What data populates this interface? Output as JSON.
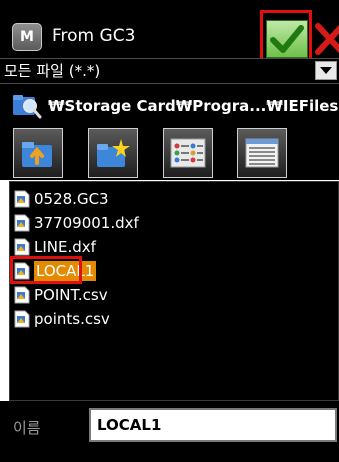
{
  "titlebar": {
    "app_icon_letter": "M",
    "title": "From GC3"
  },
  "filter": {
    "selected": "모든 파일 (*.*)"
  },
  "path": {
    "text": "₩Storage Card₩Progra...₩IEFiles"
  },
  "toolbar": {
    "buttons": [
      {
        "icon": "folder-up-icon"
      },
      {
        "icon": "new-folder-icon"
      },
      {
        "icon": "list-view-icon"
      },
      {
        "icon": "details-view-icon"
      }
    ]
  },
  "files": [
    {
      "name": "0528.GC3"
    },
    {
      "name": "37709001.dxf"
    },
    {
      "name": "LINE.dxf"
    },
    {
      "name": "LOCAL1",
      "selected": true
    },
    {
      "name": "POINT.csv"
    },
    {
      "name": "points.csv"
    }
  ],
  "name_field": {
    "label": "이름",
    "value": "LOCAL1"
  },
  "colors": {
    "selection": "#e38a00",
    "highlight": "#e01010",
    "ok": "#6fc04a"
  }
}
